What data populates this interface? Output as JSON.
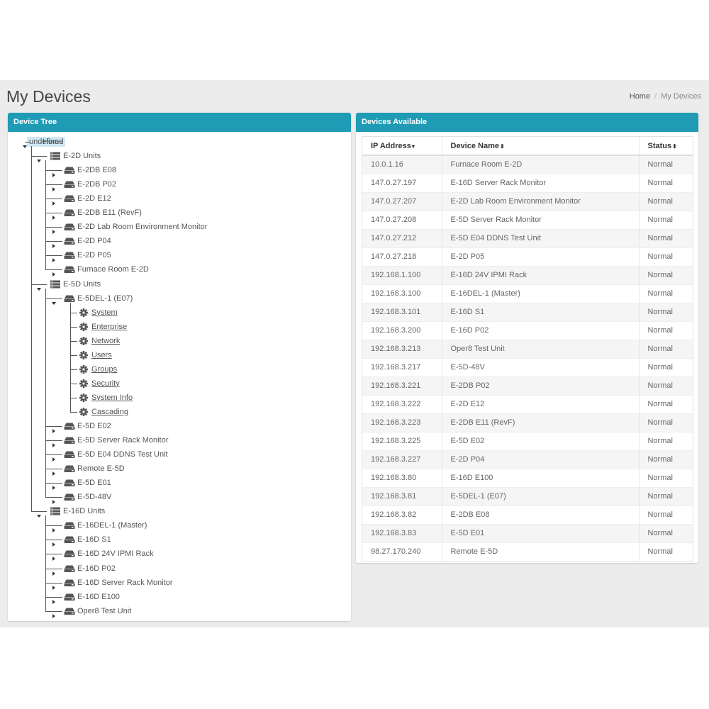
{
  "header": {
    "title": "My Devices",
    "breadcrumb": {
      "home": "Home",
      "separator": "/",
      "current": "My Devices"
    }
  },
  "tree_panel": {
    "title": "Device Tree",
    "root": "Home",
    "groups": [
      {
        "label": "E-2D Units",
        "devices": [
          {
            "label": "E-2DB E08"
          },
          {
            "label": "E-2DB P02"
          },
          {
            "label": "E-2D E12"
          },
          {
            "label": "E-2DB E11 (RevF)"
          },
          {
            "label": "E-2D Lab Room Environment Monitor"
          },
          {
            "label": "E-2D P04"
          },
          {
            "label": "E-2D P05"
          },
          {
            "label": "Furnace Room E-2D"
          }
        ]
      },
      {
        "label": "E-5D Units",
        "devices": [
          {
            "label": "E-5DEL-1 (E07)",
            "expanded": true,
            "children": [
              "System",
              "Enterprise",
              "Network",
              "Users",
              "Groups",
              "Security",
              "System Info",
              "Cascading"
            ]
          },
          {
            "label": "E-5D E02"
          },
          {
            "label": "E-5D Server Rack Monitor"
          },
          {
            "label": "E-5D E04 DDNS Test Unit"
          },
          {
            "label": "Remote E-5D"
          },
          {
            "label": "E-5D E01"
          },
          {
            "label": "E-5D-48V"
          }
        ]
      },
      {
        "label": "E-16D Units",
        "devices": [
          {
            "label": "E-16DEL-1 (Master)"
          },
          {
            "label": "E-16D S1"
          },
          {
            "label": "E-16D 24V IPMI Rack"
          },
          {
            "label": "E-16D P02"
          },
          {
            "label": "E-16D Server Rack Monitor"
          },
          {
            "label": "E-16D E100"
          },
          {
            "label": "Oper8 Test Unit"
          }
        ]
      }
    ]
  },
  "devices_panel": {
    "title": "Devices Available",
    "columns": [
      {
        "label": "IP Address",
        "sort": "▾"
      },
      {
        "label": "Device Name",
        "sort": "⬍"
      },
      {
        "label": "Status",
        "sort": "⬍"
      }
    ],
    "rows": [
      [
        "10.0.1.16",
        "Furnace Room E-2D",
        "Normal"
      ],
      [
        "147.0.27.197",
        "E-16D Server Rack Monitor",
        "Normal"
      ],
      [
        "147.0.27.207",
        "E-2D Lab Room Environment Monitor",
        "Normal"
      ],
      [
        "147.0.27.208",
        "E-5D Server Rack Monitor",
        "Normal"
      ],
      [
        "147.0.27.212",
        "E-5D E04 DDNS Test Unit",
        "Normal"
      ],
      [
        "147.0.27.218",
        "E-2D P05",
        "Normal"
      ],
      [
        "192.168.1.100",
        "E-16D 24V IPMI Rack",
        "Normal"
      ],
      [
        "192.168.3.100",
        "E-16DEL-1 (Master)",
        "Normal"
      ],
      [
        "192.168.3.101",
        "E-16D S1",
        "Normal"
      ],
      [
        "192.168.3.200",
        "E-16D P02",
        "Normal"
      ],
      [
        "192.168.3.213",
        "Oper8 Test Unit",
        "Normal"
      ],
      [
        "192.168.3.217",
        "E-5D-48V",
        "Normal"
      ],
      [
        "192.168.3.221",
        "E-2DB P02",
        "Normal"
      ],
      [
        "192.168.3.222",
        "E-2D E12",
        "Normal"
      ],
      [
        "192.168.3.223",
        "E-2DB E11 (RevF)",
        "Normal"
      ],
      [
        "192.168.3.225",
        "E-5D E02",
        "Normal"
      ],
      [
        "192.168.3.227",
        "E-2D P04",
        "Normal"
      ],
      [
        "192.168.3.80",
        "E-16D E100",
        "Normal"
      ],
      [
        "192.168.3.81",
        "E-5DEL-1 (E07)",
        "Normal"
      ],
      [
        "192.168.3.82",
        "E-2DB E08",
        "Normal"
      ],
      [
        "192.168.3.83",
        "E-5D E01",
        "Normal"
      ],
      [
        "98.27.170.240",
        "Remote E-5D",
        "Normal"
      ]
    ]
  },
  "colors": {
    "panel_header": "#1f9bb5",
    "page_bg": "#ececec",
    "home_highlight": "#cfe8f5"
  },
  "icons": {
    "root": "home-icon",
    "group": "server-stack-icon",
    "device": "device-icon",
    "setting": "gear-icon"
  }
}
